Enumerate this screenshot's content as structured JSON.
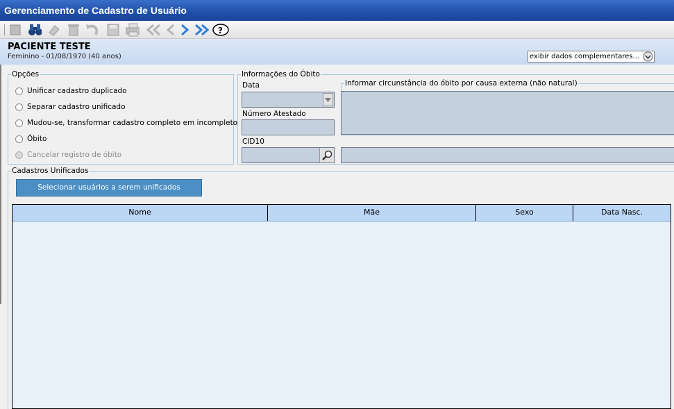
{
  "window": {
    "title": "Gerenciamento de Cadastro de Usuário"
  },
  "toolbar": {
    "icons": [
      "new-icon",
      "binoculars-icon",
      "eraser-icon",
      "trash-icon",
      "undo-icon",
      "save-icon",
      "print-icon",
      "first-icon",
      "previous-icon",
      "next-icon",
      "last-icon",
      "help-icon"
    ]
  },
  "patient": {
    "name": "PACIENTE TESTE",
    "details": "Feminino - 01/08/1970 (40 anos)",
    "complement_select": "exibir dados complementares..."
  },
  "options": {
    "legend": "Opções",
    "items": [
      {
        "label": "Unificar cadastro duplicado",
        "enabled": true
      },
      {
        "label": "Separar cadastro unificado",
        "enabled": true
      },
      {
        "label": "Mudou-se, transformar cadastro completo em incompleto",
        "enabled": true
      },
      {
        "label": "Óbito",
        "enabled": true
      },
      {
        "label": "Cancelar registro de óbito",
        "enabled": false
      }
    ]
  },
  "death": {
    "legend": "Informações do Óbito",
    "date_label": "Data",
    "date_value": "",
    "certificate_label": "Número Atestado",
    "certificate_value": "",
    "cid10_label": "CID10",
    "cid10_code": "",
    "cid10_description": "",
    "external_cause_legend": "Informar circunstância do óbito por causa externa (não natural)",
    "external_cause_value": ""
  },
  "unified": {
    "legend": "Cadastros Unificados",
    "select_button": "Selecionar usuários a serem unificados",
    "columns": [
      "Nome",
      "Mãe",
      "Sexo",
      "Data Nasc."
    ],
    "rows": []
  },
  "colors": {
    "titlebar": "#1f4fa8",
    "grid_header": "#bcd6f5",
    "button": "#4b8fc4",
    "field": "#c5d0de"
  }
}
